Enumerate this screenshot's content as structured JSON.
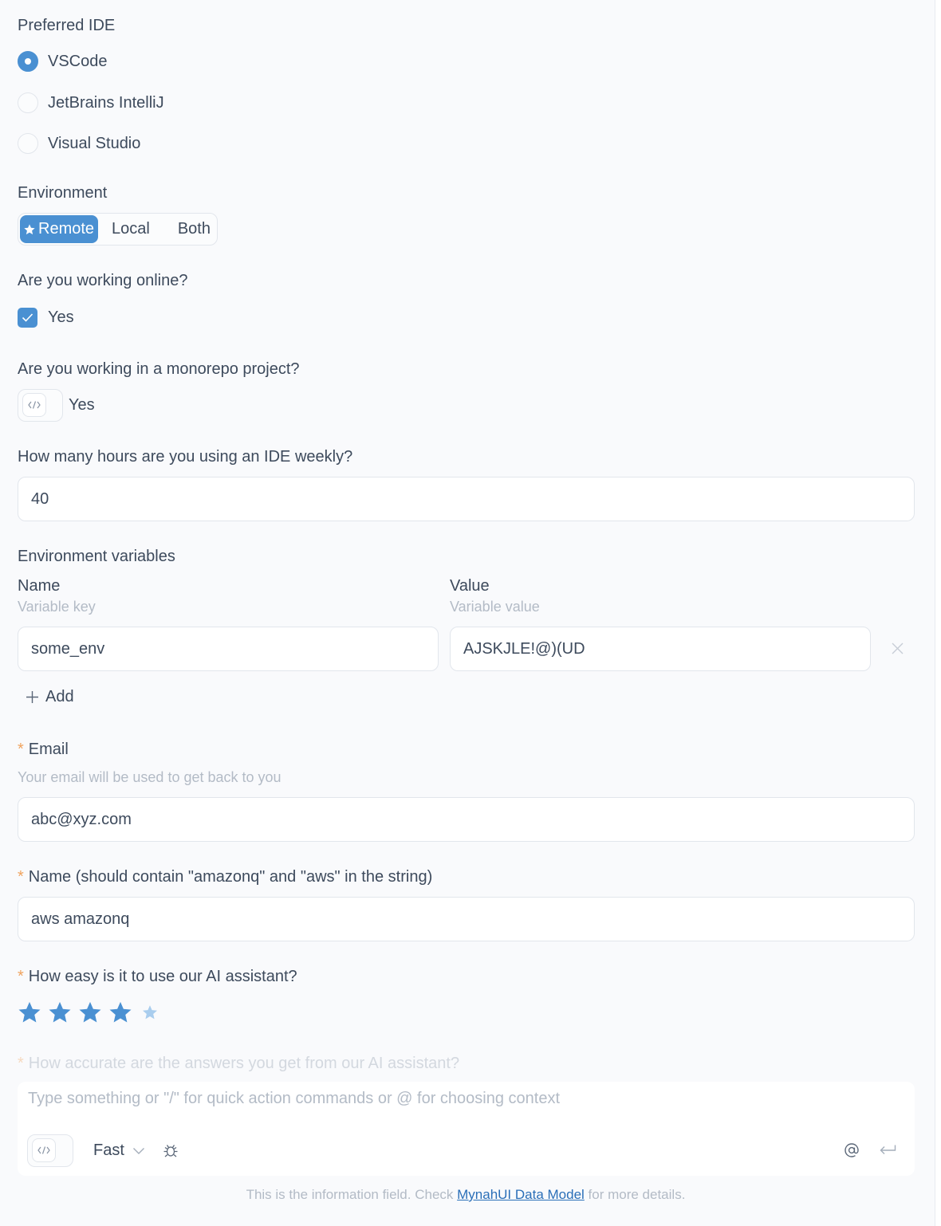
{
  "ide": {
    "label": "Preferred IDE",
    "options": [
      {
        "label": "VSCode",
        "selected": true
      },
      {
        "label": "JetBrains IntelliJ",
        "selected": false
      },
      {
        "label": "Visual Studio",
        "selected": false
      }
    ]
  },
  "environment": {
    "label": "Environment",
    "options": [
      "Remote",
      "Local",
      "Both"
    ],
    "selected": "Remote"
  },
  "online": {
    "label": "Are you working online?",
    "option_label": "Yes",
    "checked": true
  },
  "monorepo": {
    "label": "Are you working in a monorepo project?",
    "option_label": "Yes"
  },
  "hours": {
    "label": "How many hours are you using an IDE weekly?",
    "value": "40"
  },
  "env_vars": {
    "label": "Environment variables",
    "name_header": "Name",
    "name_desc": "Variable key",
    "value_header": "Value",
    "value_desc": "Variable value",
    "rows": [
      {
        "name": "some_env",
        "value": "AJSKJLE!@)(UD"
      }
    ],
    "add_label": "Add"
  },
  "email": {
    "required_mark": "*",
    "label": "Email",
    "desc": "Your email will be used to get back to you",
    "value": "abc@xyz.com"
  },
  "name_field": {
    "required_mark": "*",
    "label": "Name (should contain \"amazonq\" and \"aws\" in the string)",
    "value": "aws amazonq"
  },
  "ease": {
    "required_mark": "*",
    "label": "How easy is it to use our AI assistant?",
    "rating": 4,
    "max": 5
  },
  "accuracy": {
    "required_mark": "*",
    "label": "How accurate are the answers you get from our AI assistant?"
  },
  "prompt": {
    "placeholder": "Type something or \"/\" for quick action commands or @ for choosing context",
    "mode": "Fast"
  },
  "info": {
    "prefix": "This is the information field. Check ",
    "link": "MynahUI Data Model",
    "suffix": " for more details."
  },
  "colors": {
    "accent": "#4a90d2",
    "required": "#f0a35e",
    "muted": "#b3bbc6"
  },
  "icons": [
    "radio-icon",
    "star-icon",
    "check-icon",
    "code-icon",
    "close-icon",
    "plus-icon",
    "chevron-down-icon",
    "bug-icon",
    "at-icon",
    "enter-icon"
  ]
}
